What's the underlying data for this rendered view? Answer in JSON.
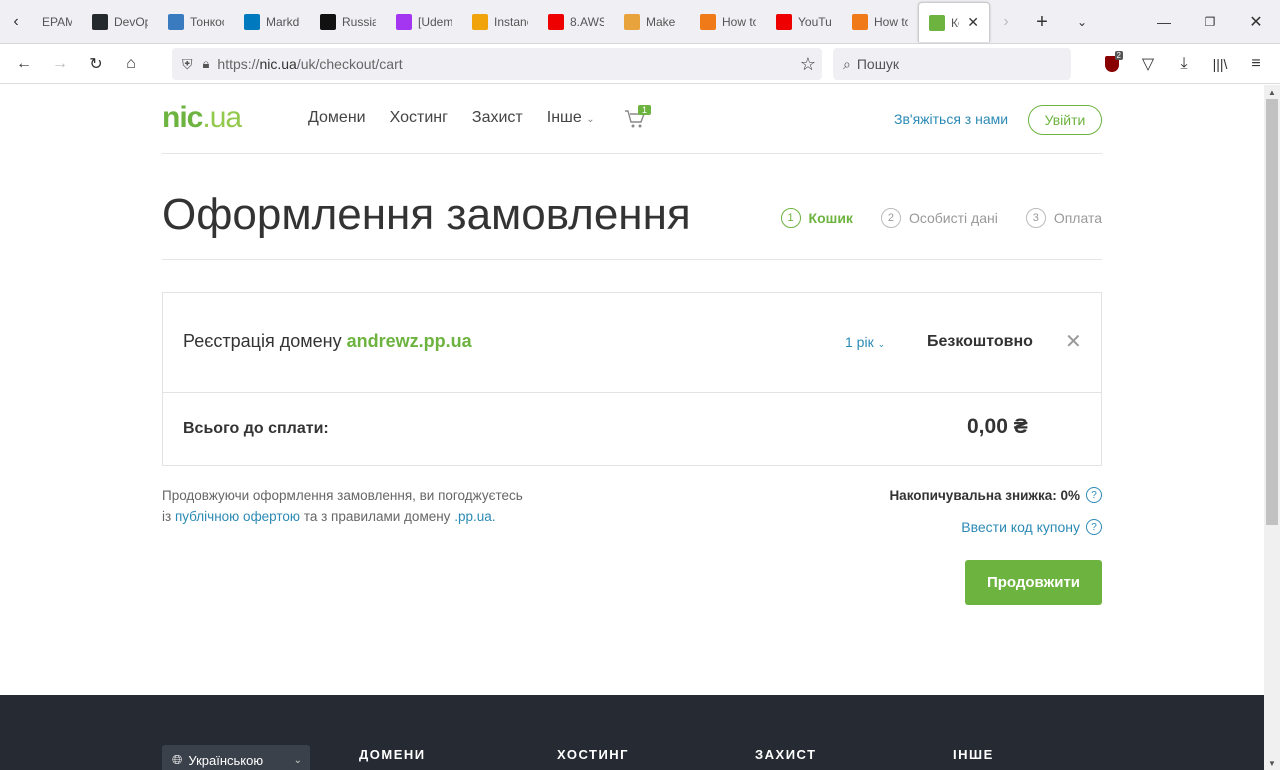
{
  "browser": {
    "tabs": [
      {
        "label": "EPAM",
        "icon": "epam-icon",
        "color": "#555"
      },
      {
        "label": "DevOps",
        "icon": "github-icon",
        "color": "#24292e"
      },
      {
        "label": "Тонкости",
        "icon": "snowflake-icon",
        "color": "#3a7bbf"
      },
      {
        "label": "Markdown",
        "icon": "trello-icon",
        "color": "#0079bf"
      },
      {
        "label": "Russian",
        "icon": "dots-icon",
        "color": "#111"
      },
      {
        "label": "[Udemy]",
        "icon": "star-icon",
        "color": "#a435f0"
      },
      {
        "label": "Instances",
        "icon": "aws-icon",
        "color": "#f0a30a"
      },
      {
        "label": "8.AWS",
        "icon": "youtube-icon",
        "color": "#e00"
      },
      {
        "label": "Make",
        "icon": "box-icon",
        "color": "#e8a33d"
      },
      {
        "label": "How to",
        "icon": "cube-icon",
        "color": "#f07a18"
      },
      {
        "label": "YouTube",
        "icon": "youtube-icon",
        "color": "#e00"
      },
      {
        "label": "How to",
        "icon": "cube-icon",
        "color": "#f07a18"
      },
      {
        "label": "Кошик",
        "icon": "nic-icon",
        "color": "#6db33f"
      }
    ],
    "url": "https://nic.ua/uk/checkout/cart",
    "url_host": "nic.ua",
    "url_prefix": "https://",
    "url_path": "/uk/checkout/cart",
    "search_placeholder": "Пошук",
    "extension_badge": "2"
  },
  "header": {
    "logo_main": "nic",
    "logo_ext": ".ua",
    "nav": [
      "Домени",
      "Хостинг",
      "Захист",
      "Інше"
    ],
    "cart_count": "1",
    "contact_label": "Зв'яжіться з нами",
    "login_label": "Увійти"
  },
  "page": {
    "title": "Оформлення замовлення",
    "steps": [
      {
        "num": "1",
        "label": "Кошик"
      },
      {
        "num": "2",
        "label": "Особисті дані"
      },
      {
        "num": "3",
        "label": "Оплата"
      }
    ]
  },
  "cart": {
    "item_prefix": "Реєстрація домену",
    "item_domain": "andrewz.pp.ua",
    "period": "1 рік",
    "price": "Безкоштовно",
    "total_label": "Всього до сплати:",
    "total_value": "0,00 ₴"
  },
  "terms": {
    "line1": "Продовжуючи оформлення замовлення, ви погоджуєтесь",
    "line2_a": "із",
    "link1": "публічною офертою",
    "line2_b": "та з правилами домену",
    "link2": ".pp.ua."
  },
  "discount": {
    "label": "Накопичувальна знижка: 0%",
    "coupon_label": "Ввести код купону",
    "continue_label": "Продовжити"
  },
  "footer": {
    "language": "Українською",
    "columns": [
      "ДОМЕНИ",
      "ХОСТИНГ",
      "ЗАХИСТ",
      "ІНШЕ"
    ]
  }
}
